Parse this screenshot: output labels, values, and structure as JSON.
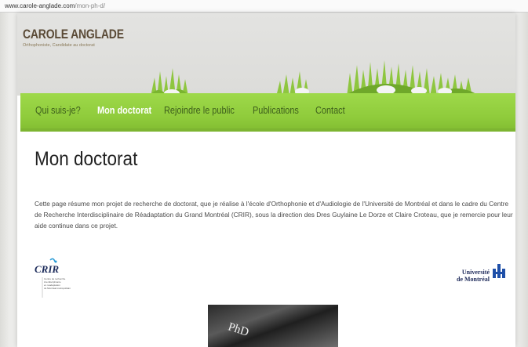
{
  "browser": {
    "url_domain": "www.carole-anglade.com",
    "url_path": "/mon-ph-d/"
  },
  "site": {
    "title": "CAROLE ANGLADE",
    "subtitle": "Orthophoniste, Candidate au doctorat"
  },
  "nav": {
    "items": [
      {
        "label": "Qui suis-je?",
        "active": false
      },
      {
        "label": "Mon doctorat",
        "active": true
      },
      {
        "label": "Rejoindre le public",
        "active": false
      },
      {
        "label": "Publications",
        "active": false
      },
      {
        "label": "Contact",
        "active": false
      }
    ]
  },
  "main": {
    "heading": "Mon doctorat",
    "intro": "Cette page résume mon projet de recherche de doctorat, que je réalise à l'école d'Orthophonie et d'Audiologie de l'Université de Montréal et dans le cadre du Centre de Recherche Interdisciplinaire de Réadaptation du Grand Montréal (CRIR), sous la direction des Dres Guylaine Le Dorze et Claire Croteau, que je remercie pour leur aide continue dans ce projet."
  },
  "logos": {
    "crir_name": "CRIR",
    "crir_caption": "Centre de recherche interdisciplinaire en réadaptation du Montréal métropolitain",
    "udem_line1": "Université",
    "udem_line2": "de Montréal"
  },
  "image": {
    "caption_text": "PhD"
  },
  "colors": {
    "nav_green": "#8fcb3b",
    "nav_active_text": "#ffffff",
    "nav_text": "#3d5e1c",
    "title_brown": "#5a4a36"
  }
}
